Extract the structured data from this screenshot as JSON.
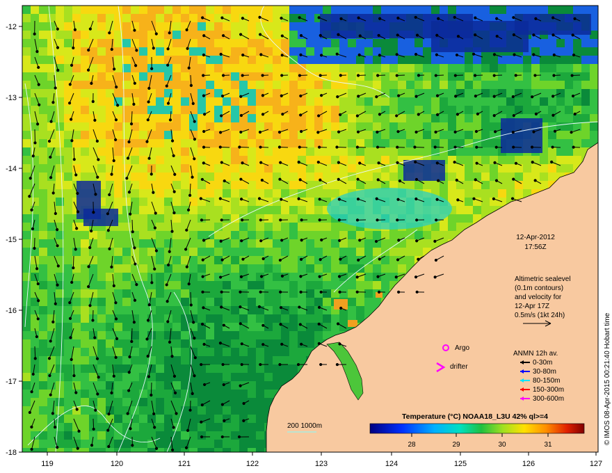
{
  "map": {
    "date": "12-Apr-2012",
    "time": "17:56Z",
    "altimetry_note": [
      "Altimetric sealevel",
      "(0.1m contours)",
      "and velocity for",
      "12-Apr 17Z",
      "0.5m/s (1kt 24h)"
    ],
    "markers": {
      "argo": "Argo",
      "drifter": "drifter"
    },
    "anmn": {
      "title": "ANMN 12h av.",
      "items": [
        {
          "label": "0-30m",
          "color": "#000000"
        },
        {
          "label": "30-80m",
          "color": "#0000ff"
        },
        {
          "label": "80-150m",
          "color": "#00e5ff"
        },
        {
          "label": "150-300m",
          "color": "#ff0000"
        },
        {
          "label": "300-600m",
          "color": "#ff00ff"
        }
      ]
    },
    "bathymetry_label": "200  1000m",
    "colorbar": {
      "title": "Temperature (°C) NOAA18_L3U 42% ql>=4",
      "ticks": [
        "28",
        "29",
        "30",
        "31"
      ]
    },
    "credit": "© IMOS 08-Apr-2015 00:21:40 Hobart time",
    "x_ticks": [
      "119",
      "120",
      "121",
      "122",
      "123",
      "124",
      "125",
      "126",
      "127"
    ],
    "y_ticks": [
      "-12",
      "-13",
      "-14",
      "-15",
      "-16",
      "-17",
      "-18"
    ],
    "colors": {
      "land": "#f8c9a0",
      "ocean_base": "#5fcf3f"
    }
  }
}
